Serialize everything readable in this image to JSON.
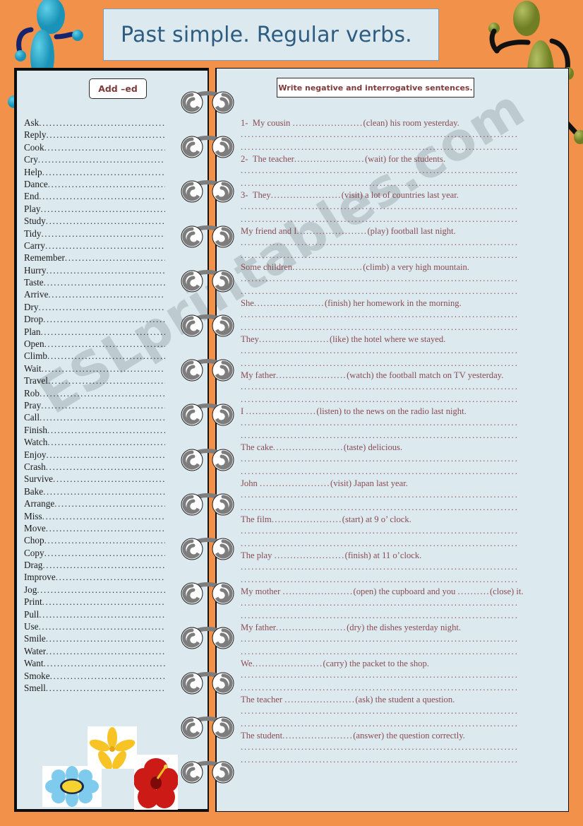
{
  "page": {
    "title": "Past simple. Regular verbs.",
    "watermark": "ESLprintables.com",
    "background_color": "#f2924a",
    "panel_color": "#dceaf0",
    "title_text_color": "#2e5c80",
    "sentence_text_color": "#8a4b50",
    "verb_text_color": "#1a1a1a"
  },
  "left_panel": {
    "heading": "Add –ed",
    "verbs": [
      "Ask",
      "Reply",
      "Cook",
      "Cry",
      "Help",
      "Dance",
      "End",
      "Play",
      "Study",
      "Tidy",
      "Carry",
      "Remember",
      "Hurry",
      "Taste",
      "Arrive",
      "Dry",
      "Drop",
      "Plan",
      "Open",
      "Climb",
      "Wait",
      "Travel",
      "Rob",
      "Pray",
      "Call",
      "Finish",
      "Watch",
      "Enjoy",
      "Crash",
      "Survive",
      "Bake",
      "Arrange",
      "Miss",
      "Move",
      "Chop",
      "Copy",
      "Drag",
      "Improve",
      "Jog",
      "Print",
      "Pull",
      "Use",
      "Smile",
      "Water",
      "Want",
      "Smoke",
      "Smell"
    ],
    "decorations": [
      "blue-daisy-flower",
      "yellow-star-flower",
      "red-hibiscus-flower"
    ]
  },
  "right_panel": {
    "heading": "Write negative and interrogative sentences.",
    "sentences": [
      {
        "number": "1-",
        "before": "My cousin ",
        "verb": "(clean)",
        "after": " his room yesterday."
      },
      {
        "number": "2-",
        "before": "The teacher",
        "verb": "(wait)",
        "after": " for the students."
      },
      {
        "number": "3-",
        "before": "They",
        "verb": "(visit)",
        "after": " a lot of countries last year."
      },
      {
        "number": "",
        "before": "My friend and I",
        "verb": "(play)",
        "after": " football last night."
      },
      {
        "number": "",
        "before": "Some children",
        "verb": "(climb)",
        "after": " a very high mountain."
      },
      {
        "number": "",
        "before": "She",
        "verb": "(finish)",
        "after": " her homework in the morning."
      },
      {
        "number": "",
        "before": "They",
        "verb": "(like)",
        "after": " the hotel where we stayed."
      },
      {
        "number": "",
        "before": "My father",
        "verb": "(watch)",
        "after": " the football match on TV yesterday."
      },
      {
        "number": "",
        "before": "I ",
        "verb": "(listen)",
        "after": " to the news on the radio last night."
      },
      {
        "number": "",
        "before": "The cake",
        "verb": "(taste)",
        "after": " delicious."
      },
      {
        "number": "",
        "before": "John ",
        "verb": "(visit)",
        "after": "  Japan last year."
      },
      {
        "number": "",
        "before": "The film",
        "verb": "(start)",
        "after": " at 9 o’ clock."
      },
      {
        "number": "",
        "before": "The play ",
        "verb": "(finish)",
        "after": " at 11 o’clock."
      },
      {
        "number": "",
        "before": "My mother ",
        "verb": "(open)",
        "after": " the cupboard and you ",
        "verb2": "(close)",
        "after2": " it."
      },
      {
        "number": "",
        "before": "My father",
        "verb": "(dry)",
        "after": " the dishes yesterday night."
      },
      {
        "number": "",
        "before": "We",
        "verb": "(carry)",
        "after": " the packet to the shop."
      },
      {
        "number": "",
        "before": "The teacher ",
        "verb": "(ask)",
        "after": " the student a question."
      },
      {
        "number": "",
        "before": "The student",
        "verb": "(answer)",
        "after": " the question correctly."
      }
    ]
  },
  "binding": {
    "ring_count": 16,
    "strip_color": "#f2924a",
    "spiral_color": "#7d7d7d"
  },
  "figures": [
    {
      "name": "blue-stick-figure",
      "color": "#2aa3c4",
      "limb_color": "#16246e",
      "position": "top-left"
    },
    {
      "name": "green-stick-figure",
      "color": "#8a9b3d",
      "limb_color": "#111111",
      "position": "top-right"
    }
  ]
}
